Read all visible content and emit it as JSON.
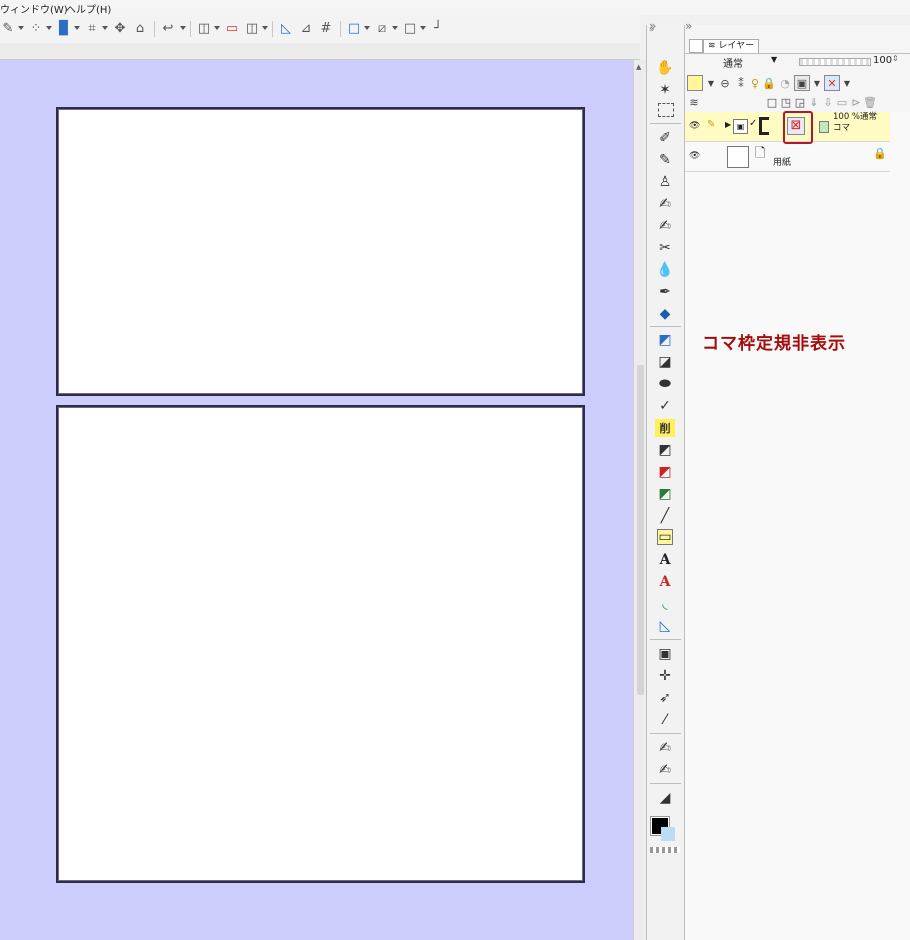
{
  "menubar": {
    "window": "ウィンドウ(W)",
    "help": "ヘルプ(H)"
  },
  "layer_panel": {
    "tab_label": "レイヤー",
    "blend_mode": "通常",
    "opacity_value": "100",
    "layers": [
      {
        "opacity_mode": "100 %通常",
        "name": "コマ"
      },
      {
        "name": "用紙"
      }
    ]
  },
  "annotation": {
    "text": "コマ枠定規非表示",
    "color": "#a30d0d"
  },
  "colors": {
    "canvas_bg": "#cdcdfd",
    "panel_border": "#2e2c4a",
    "highlight": "#b2182b"
  },
  "tools": {
    "erase_label": "削",
    "text_tool": "A"
  }
}
